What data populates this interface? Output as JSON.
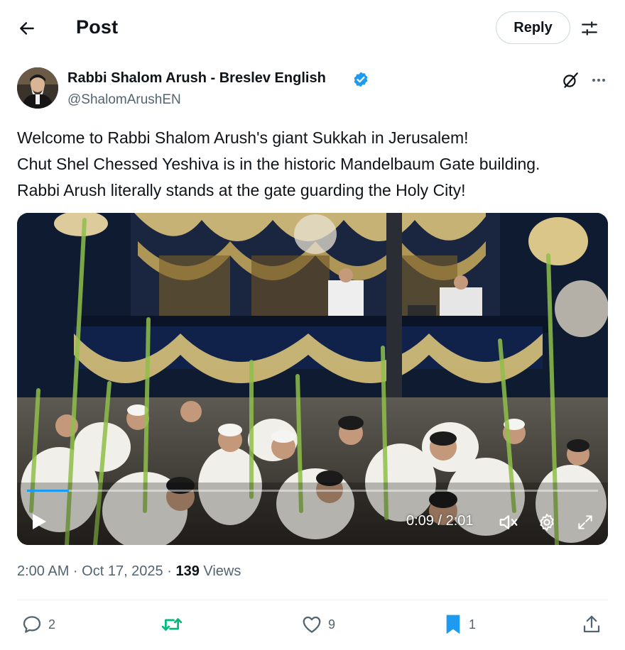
{
  "header": {
    "title": "Post",
    "reply_label": "Reply"
  },
  "author": {
    "name": "Rabbi Shalom Arush - Breslev English",
    "handle": "@ShalomArushEN",
    "verified": true
  },
  "post": {
    "lines": [
      "Welcome to Rabbi Shalom Arush's giant Sukkah in Jerusalem!",
      "Chut Shel Chessed Yeshiva is in the historic Mandelbaum Gate building.",
      "Rabbi Arush literally stands at the gate guarding the Holy City!"
    ]
  },
  "video": {
    "time_display": "0:09 / 2:01",
    "progress_fraction": 0.074
  },
  "meta": {
    "timestamp": "2:00 AM · Oct 17, 2025 · ",
    "views_count": "139",
    "views_label": " Views"
  },
  "actions": {
    "replies": "2",
    "reposts": "",
    "likes": "9",
    "bookmarks": "1"
  },
  "icons": {
    "back": "arrow-left-icon",
    "filter": "sliders-icon",
    "verified": "verified-badge-icon",
    "grok": "grok-icon",
    "more": "more-icon",
    "play": "play-icon",
    "mute": "volume-muted-icon",
    "settings": "gear-icon",
    "expand": "expand-icon",
    "reply": "comment-icon",
    "repost": "repost-icon",
    "like": "heart-icon",
    "bookmark": "bookmark-icon",
    "share": "share-icon"
  },
  "colors": {
    "accent": "#1d9bf0",
    "repost_green": "#00ba7c",
    "text": "#0f1419",
    "muted": "#536471"
  }
}
